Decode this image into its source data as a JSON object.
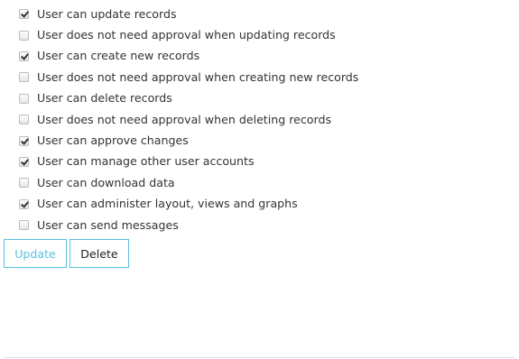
{
  "permissions": [
    {
      "label": "User can update records",
      "checked": true
    },
    {
      "label": "User does not need approval when updating records",
      "checked": false
    },
    {
      "label": "User can create new records",
      "checked": true
    },
    {
      "label": "User does not need approval when creating new records",
      "checked": false
    },
    {
      "label": "User can delete records",
      "checked": false
    },
    {
      "label": "User does not need approval when deleting records",
      "checked": false
    },
    {
      "label": "User can approve changes",
      "checked": true
    },
    {
      "label": "User can manage other user accounts",
      "checked": true
    },
    {
      "label": "User can download data",
      "checked": false
    },
    {
      "label": "User can administer layout, views and graphs",
      "checked": true
    },
    {
      "label": "User can send messages",
      "checked": false
    }
  ],
  "actions": {
    "update_label": "Update",
    "delete_label": "Delete"
  },
  "colors": {
    "accent": "#5bc0de",
    "text": "#333333"
  }
}
